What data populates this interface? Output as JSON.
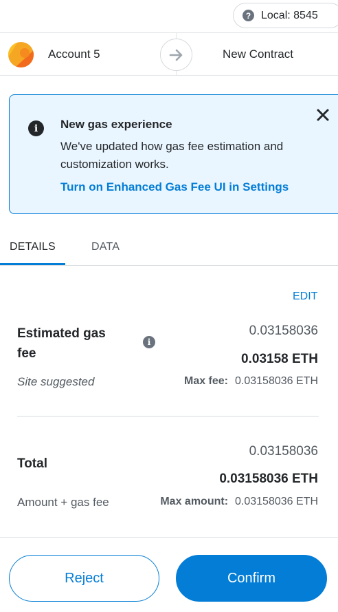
{
  "network": {
    "label": "Local: 8545",
    "icon": "question-icon"
  },
  "sender": {
    "account_name": "Account 5",
    "avatar_icon": "account-avatar"
  },
  "recipient": {
    "label": "New Contract",
    "arrow_icon": "arrow-right-icon"
  },
  "notice": {
    "title": "New gas experience",
    "body": "We've updated how gas fee estimation and customization works.",
    "link": "Turn on Enhanced Gas Fee UI in Settings",
    "close_icon": "close-icon",
    "info_icon": "info-icon"
  },
  "tabs": [
    {
      "label": "DETAILS",
      "active": true
    },
    {
      "label": "DATA",
      "active": false
    }
  ],
  "details": {
    "edit_label": "EDIT",
    "gas": {
      "label": "Estimated gas fee",
      "value_secondary": "0.03158036",
      "value_primary": "0.03158 ETH",
      "sub_left": "Site suggested",
      "max_label": "Max fee:",
      "max_value": "0.03158036 ETH"
    },
    "total": {
      "label": "Total",
      "value_secondary": "0.03158036",
      "value_primary": "0.03158036 ETH",
      "sub_left": "Amount + gas fee",
      "max_label": "Max amount:",
      "max_value": "0.03158036 ETH"
    }
  },
  "footer": {
    "reject_label": "Reject",
    "confirm_label": "Confirm"
  },
  "colors": {
    "accent": "#037dd6",
    "notice_bg": "#eaf6ff",
    "text": "#24272a",
    "muted": "#535a61"
  }
}
